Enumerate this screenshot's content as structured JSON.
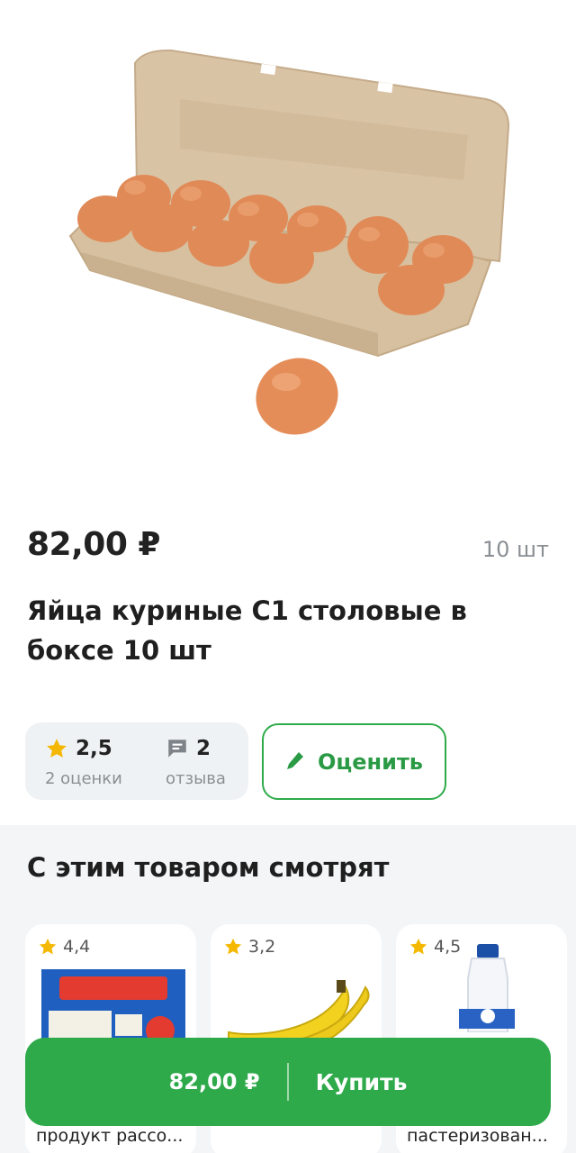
{
  "product": {
    "image_alt": "egg-carton-photo",
    "price": "82,00 ₽",
    "unit": "10 шт",
    "title": "Яйца куриные С1 столовые в боксе 10 шт"
  },
  "rating": {
    "value": "2,5",
    "count_label": "2 оценки",
    "reviews_value": "2",
    "reviews_label": "отзыва",
    "rate_button": "Оценить"
  },
  "recommendations": {
    "title": "С этим товаром смотрят",
    "items": [
      {
        "rating": "4,4",
        "caption": "продукт рассо...",
        "image": "sirtaki-cheese-pack"
      },
      {
        "rating": "3,2",
        "caption": "",
        "image": "bananas"
      },
      {
        "rating": "4,5",
        "caption": "пастеризован...",
        "image": "milk-bottle"
      }
    ]
  },
  "buy_bar": {
    "price": "82,00 ₽",
    "label": "Купить"
  },
  "colors": {
    "accent": "#2eaa4b",
    "star": "#f5b800",
    "muted": "#8a8f94"
  }
}
